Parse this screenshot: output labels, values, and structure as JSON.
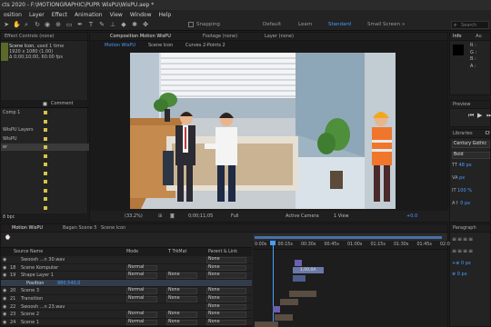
{
  "app": {
    "title": "cts 2020 - F:\\MOTIONGRAPHIC\\PUPR WisPU\\WisPU.aep *"
  },
  "menu": [
    "osition",
    "Layer",
    "Effect",
    "Animation",
    "View",
    "Window",
    "Help"
  ],
  "toolbar": {
    "snapping": "Snapping",
    "workspaces": [
      "Default",
      "Learn",
      "Standard",
      "Small Screen"
    ],
    "search_placeholder": "Search"
  },
  "project": {
    "effect_controls_tab": "Effect Controls (none)",
    "selected_name": "Scene Icon",
    "used": ", used 1 time",
    "size": "1920 x 1080 (1.00)",
    "duration": "Δ 0;00;10;00, 60.00 fps",
    "comment_header": "Comment",
    "items": [
      {
        "label": "Comp 1",
        "color": "#d4c44a"
      },
      {
        "label": "",
        "color": "#d4c44a"
      },
      {
        "label": "WisPU Layers",
        "color": "#d4c44a"
      },
      {
        "label": "WisPU",
        "color": "#d4c44a"
      },
      {
        "label": "er",
        "color": "#d4c44a"
      },
      {
        "label": "",
        "color": "#d4c44a"
      },
      {
        "label": "",
        "color": "#d4c44a"
      },
      {
        "label": "",
        "color": "#d4c44a"
      },
      {
        "label": "",
        "color": "#d4c44a"
      },
      {
        "label": "",
        "color": "#d4c44a"
      },
      {
        "label": "",
        "color": "#d4c44a"
      },
      {
        "label": "",
        "color": "#d4c44a"
      }
    ],
    "bpc": "8 bpc"
  },
  "composition": {
    "tab": "Composition Motion WisPU",
    "footage_tab": "Footage (none)",
    "layer_tab": "Layer (none)",
    "breadcrumbs": [
      "Motion WisPU",
      "Scene Icon",
      "Curves 2-Points 2"
    ],
    "zoom": "(33.2%)",
    "timecode": "0;00;11;05",
    "resolution": "Full",
    "camera": "Active Camera",
    "view": "1 View",
    "exposure": "+0.0"
  },
  "right_panel": {
    "info_tab": "Info",
    "audio_tab": "Au",
    "info_labels": [
      "R :",
      "G :",
      "B :",
      "A :"
    ],
    "preview_tab": "Preview",
    "libraries_tab": "Libraries",
    "character_tab": "Ch",
    "font": "Century Gothic",
    "font_style": "Bold",
    "font_size": "48 px",
    "tracking": "px",
    "scale": "100 %",
    "baseline": "0 px",
    "paragraph_tab": "Paragraph",
    "indent_values": [
      "+≢ 0 px",
      "≢ 0 px"
    ]
  },
  "timeline": {
    "tabs": [
      "Motion WisPU",
      "Bagan Scene 5",
      "Scene Icon"
    ],
    "headers": {
      "source": "Source Name",
      "mode": "Mode",
      "trkmat": "T TrkMat",
      "parent": "Parent & Link"
    },
    "ruler": [
      "0:00s",
      "00:15s",
      "00:30s",
      "00:45s",
      "01:00s",
      "01:15s",
      "01:30s",
      "01:45s",
      "02:0"
    ],
    "layers": [
      {
        "num": "",
        "name": "Swoosh ...n 30.wav",
        "mode": "",
        "trkmat": "",
        "parent": "None",
        "selected": false
      },
      {
        "num": "18",
        "name": "Scene Komputer",
        "mode": "Normal",
        "trkmat": "",
        "parent": "None",
        "selected": false
      },
      {
        "num": "19",
        "name": "Shape Layer 1",
        "mode": "Normal",
        "trkmat": "None",
        "parent": "None",
        "selected": false
      },
      {
        "num": "",
        "name": "Position",
        "mode": "980,540,0",
        "trkmat": "",
        "parent": "",
        "selected": true
      },
      {
        "num": "20",
        "name": "Scene 3",
        "mode": "Normal",
        "trkmat": "None",
        "parent": "None",
        "selected": false
      },
      {
        "num": "21",
        "name": "Transition",
        "mode": "Normal",
        "trkmat": "None",
        "parent": "None",
        "selected": false
      },
      {
        "num": "22",
        "name": "Swoosh ...n 23.wav",
        "mode": "",
        "trkmat": "",
        "parent": "None",
        "selected": false
      },
      {
        "num": "23",
        "name": "Scene 2",
        "mode": "Normal",
        "trkmat": "None",
        "parent": "None",
        "selected": false
      },
      {
        "num": "24",
        "name": "Scene 1",
        "mode": "Normal",
        "trkmat": "None",
        "parent": "None",
        "selected": false
      }
    ],
    "clip_label": "1,00,0A"
  },
  "colors": {
    "accent": "#4a9cff",
    "label_yellow": "#d4c44a",
    "label_blue": "#6a8fcf"
  }
}
